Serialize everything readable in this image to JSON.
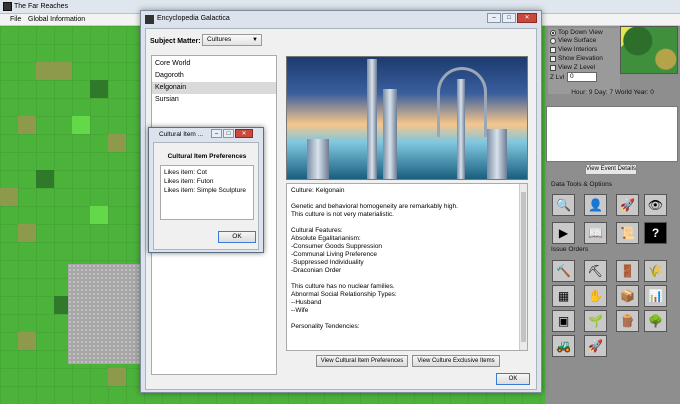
{
  "app": {
    "title": "The Far Reaches",
    "menu": [
      "File",
      "Global Information"
    ]
  },
  "right_panel": {
    "view_options": [
      "Top Down View",
      "View Surface",
      "View Interiors",
      "Show Elevation",
      "View Z Level"
    ],
    "zlvl_label": "Z Lvl",
    "zlvl_value": "0",
    "world_time": "Hour: 9 Day: 7 World Year: 0",
    "view_event_details": "View Event Details",
    "data_tools_label": "Data Tools & Options",
    "issue_orders_label": "Issue Orders",
    "help_glyph": "?"
  },
  "encyclopedia": {
    "title": "Encyclopedia Galactica",
    "subject_label": "Subject Matter:",
    "subject_value": "Cultures",
    "cultures": [
      "Core World",
      "Dagoroth",
      "Kelgonain",
      "Sursian"
    ],
    "selected_culture": "Kelgonain",
    "text_lines": [
      "Culture: Kelgonain",
      "",
      "Genetic and behavioral homogeneity are remarkably high.",
      "This culture is not very materialistic.",
      "",
      "Cultural Features:",
      "Absolute Egalitarianism:",
      "-Consumer Goods Suppression",
      "-Communal Living Preference",
      "-Suppressed Individuality",
      "-Draconian Order",
      "",
      "This culture has no nuclear families.",
      "Abnormal Social Relationship Types:",
      "--Husband",
      "--Wife",
      "",
      "Personality Tendencies:"
    ],
    "btn_item_prefs": "View Cultural Item Preferences",
    "btn_exclusive": "View Culture Exclusive Items",
    "btn_ok": "OK"
  },
  "cultural_item_dialog": {
    "title": "Cultural Item ...",
    "heading": "Cultural Item Preferences",
    "items": [
      "Likes item: Cot",
      "Likes item: Futon",
      "Likes item: Simple Sculpture"
    ],
    "ok": "OK"
  }
}
